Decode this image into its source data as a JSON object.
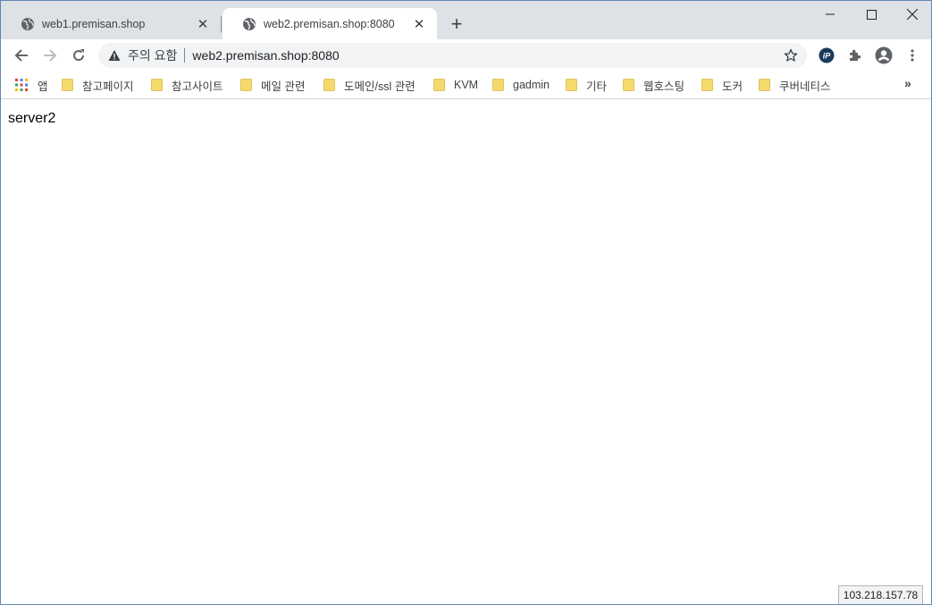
{
  "tabs": [
    {
      "title": "web1.premisan.shop",
      "active": false
    },
    {
      "title": "web2.premisan.shop:8080",
      "active": true
    }
  ],
  "toolbar": {
    "security_label": "주의 요함",
    "url": "web2.premisan.shop:8080"
  },
  "bookmarks": [
    {
      "label": "앱",
      "icon": "apps-grid-icon"
    },
    {
      "label": "참고페이지",
      "icon": "folder-icon"
    },
    {
      "label": "참고사이트",
      "icon": "folder-icon"
    },
    {
      "label": "메일 관련",
      "icon": "folder-icon"
    },
    {
      "label": "도메인/ssl 관련",
      "icon": "folder-icon"
    },
    {
      "label": "KVM",
      "icon": "folder-icon"
    },
    {
      "label": "gadmin",
      "icon": "folder-icon"
    },
    {
      "label": "기타",
      "icon": "folder-icon"
    },
    {
      "label": "웹호스팅",
      "icon": "folder-icon"
    },
    {
      "label": "도커",
      "icon": "folder-icon"
    },
    {
      "label": "쿠버네티스",
      "icon": "folder-icon"
    }
  ],
  "page": {
    "body_text": "server2"
  },
  "status": {
    "ip": "103.218.157.78"
  },
  "colors": {
    "tabstrip": "#dee1e6",
    "omnibox": "#f1f3f4",
    "folder": "#f5d96b",
    "window_border": "#5f87b5"
  }
}
